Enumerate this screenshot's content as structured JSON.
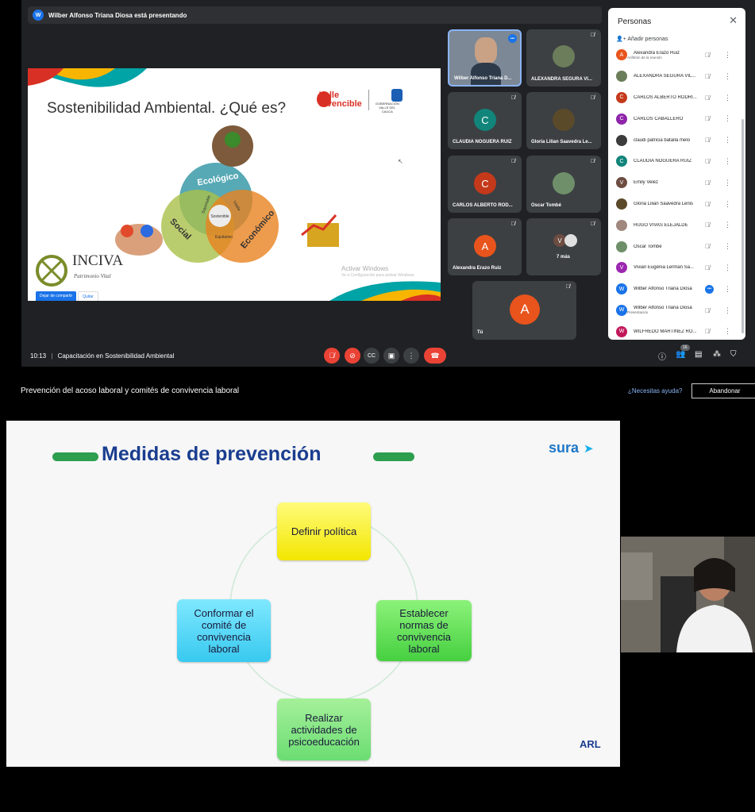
{
  "meet": {
    "presenting_banner": "Wilber Alfonso Triana Diosa está presentando",
    "presenter_avatar": "W",
    "time": "10:13",
    "separator": "|",
    "meeting_name": "Capacitación en Sostenibilidad Ambiental",
    "participant_count": "16",
    "share_controls": {
      "stop_label": "Dejar de compartir",
      "remove_label": "Quitar"
    }
  },
  "slide1": {
    "title": "Sostenibilidad Ambiental. ¿Qué es?",
    "venn_labels": [
      "Ecológico",
      "Social",
      "Económico",
      "Soportable",
      "Viable",
      "Equitativo",
      "Sostenible"
    ],
    "brand": "Valle Invencible",
    "brand_line1": "Valle",
    "brand_line2": "Invencible",
    "gobernacion": "GOBERNACIÓN VALLE DEL CAUCA",
    "inciva": "INCIVA",
    "inciva_sub": "Patrimonio Vital",
    "activate_title": "Activar Windows",
    "activate_sub": "Ve a Configuración para activar Windows."
  },
  "tiles": [
    {
      "name": "Wilber Alfonso Triana D...",
      "label": "Wilber Alfonso Triana D..."
    },
    {
      "name": "ALEXANDRA SEGURA VI..."
    },
    {
      "name": "CLAUDIA NOGUERA RUIZ",
      "initial": "C",
      "color": "#12857b"
    },
    {
      "name": "Gloria Lilian Saavedra Le..."
    },
    {
      "name": "CARLOS ALBERTO ROD...",
      "initial": "C",
      "color": "#c5391b"
    },
    {
      "name": "Oscar Tombé"
    },
    {
      "name": "Alexandra Erazo Ruiz",
      "initial": "A",
      "color": "#e8541c"
    },
    {
      "name": "7 más",
      "initial": "V"
    },
    {
      "name": "Tú",
      "initial": "A",
      "color": "#e8541c"
    }
  ],
  "people_panel": {
    "title": "Personas",
    "add_label": "Añadir personas",
    "participants": [
      {
        "initial": "A",
        "color": "#e8541c",
        "name": "Alexandra Erazo Ruiz",
        "sub": "Anfitrión de la reunión"
      },
      {
        "initial": "",
        "color": "#6b7d5a",
        "name": "ALEXANDRA SEGURA VIL..."
      },
      {
        "initial": "C",
        "color": "#c5391b",
        "name": "CARLOS ALBERTO RODRI..."
      },
      {
        "initial": "C",
        "color": "#8e24aa",
        "name": "CARLOS CABALLERO"
      },
      {
        "initial": "",
        "color": "#3c3c3c",
        "name": "claudi patricia bataIla melo"
      },
      {
        "initial": "C",
        "color": "#12857b",
        "name": "CLAUDIA NOGUERA RUIZ"
      },
      {
        "initial": "V",
        "color": "#6d4c41",
        "name": "Emily Velez"
      },
      {
        "initial": "",
        "color": "#5b4a2a",
        "name": "Gloria Lilian Saavedra Lenis"
      },
      {
        "initial": "",
        "color": "#a1887f",
        "name": "HUGO VIVAS ELEJALDE"
      },
      {
        "initial": "",
        "color": "#6f8f6a",
        "name": "Oscar Tombé"
      },
      {
        "initial": "V",
        "color": "#9c27b0",
        "name": "Vivian Eugenia Lerman Sa..."
      },
      {
        "initial": "W",
        "color": "#1a73e8",
        "name": "Wilber Alfonso Triana Diosa"
      },
      {
        "initial": "W",
        "color": "#1a73e8",
        "name": "Wilber Alfonso Triana Diosa",
        "sub": "Presentación"
      },
      {
        "initial": "W",
        "color": "#c2185b",
        "name": "WILFREDO MARTINEZ RO..."
      }
    ]
  },
  "course": {
    "title": "Prevención del acoso laboral y comités de convivencia laboral",
    "help": "¿Necesitas ayuda?",
    "exit": "Abandonar"
  },
  "slide2": {
    "title": "Medidas de prevención",
    "brand": "sura",
    "footer": "ARL",
    "steps": [
      "Definir política",
      "Establecer normas de convivencia laboral",
      "Realizar actividades de psicoeducación",
      "Conformar el comité de convivencia laboral"
    ]
  },
  "icons": [
    "mic-off-icon",
    "cam-off-icon",
    "captions-icon",
    "present-icon",
    "more-icon",
    "hangup-icon",
    "info-icon",
    "people-icon",
    "chat-icon",
    "activities-icon",
    "shield-icon",
    "close-icon",
    "add-person-icon",
    "pin-icon",
    "more-vert-icon"
  ]
}
